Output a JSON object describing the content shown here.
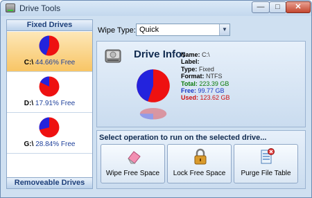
{
  "window": {
    "title": "Drive Tools",
    "minimize": "—",
    "maximize": "□",
    "close": "✕"
  },
  "left": {
    "fixed_header": "Fixed Drives",
    "removable_header": "Removeable Drives",
    "drives": [
      {
        "letter": "C:\\",
        "free_text": "44.66%  Free",
        "free_fraction": 0.4466,
        "selected": true
      },
      {
        "letter": "D:\\",
        "free_text": "17.91%  Free",
        "free_fraction": 0.1791,
        "selected": false
      },
      {
        "letter": "G:\\",
        "free_text": "28.84%  Free",
        "free_fraction": 0.2884,
        "selected": false
      }
    ]
  },
  "wipe": {
    "label": "Wipe Type:",
    "value": "Quick"
  },
  "info": {
    "title": "Drive Info:",
    "free_fraction": 0.4466,
    "name_label": "Name:",
    "name_value": "C:\\",
    "label_label": "Label:",
    "label_value": "",
    "type_label": "Type:",
    "type_value": "Fixed",
    "format_label": "Format:",
    "format_value": "NTFS",
    "total_label": "Total:",
    "total_value": "223.39 GB",
    "free_label": "Free:",
    "free_value": "99.77 GB",
    "used_label": "Used:",
    "used_value": "123.62 GB"
  },
  "ops": {
    "title": "Select operation to run on the selected drive...",
    "wipe_label": "Wipe Free Space",
    "lock_label": "Lock Free Space",
    "purge_label": "Purge File Table"
  },
  "colors": {
    "free": "#2323dd",
    "used": "#ee1111",
    "selected_bg": "#f8c565"
  },
  "icons": {
    "app": "drive-tools-icon",
    "drive": "hard-drive-icon",
    "wipe": "eraser-icon",
    "lock": "padlock-icon",
    "purge": "file-table-delete-icon"
  }
}
